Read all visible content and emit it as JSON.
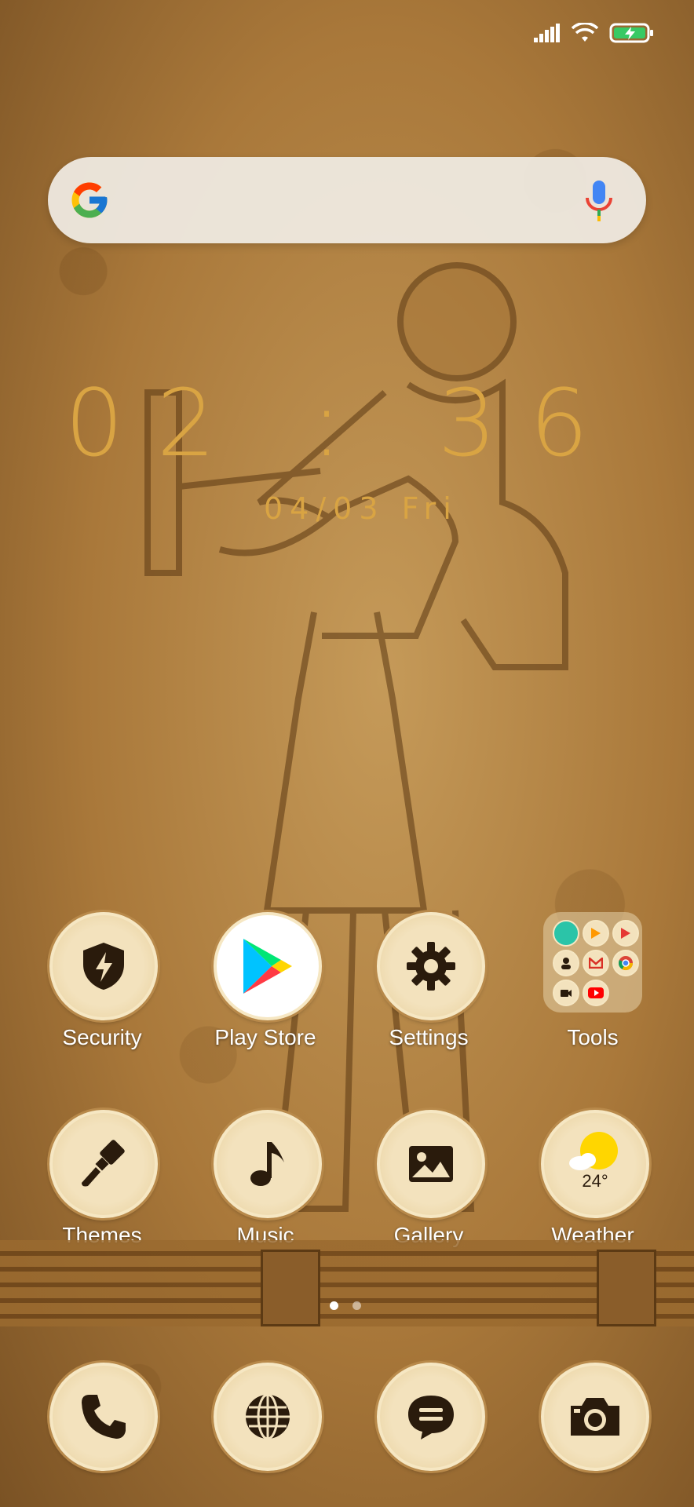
{
  "status": {
    "icons": [
      "signal-icon",
      "wifi-icon",
      "battery-charging-icon"
    ]
  },
  "search": {
    "icon_left": "google-logo-icon",
    "icon_right": "mic-icon"
  },
  "clock": {
    "time": "02 : 36",
    "date": "04/03  Fri"
  },
  "apps": [
    {
      "label": "Security",
      "icon": "shield-bolt-icon"
    },
    {
      "label": "Play Store",
      "icon": "play-store-icon"
    },
    {
      "label": "Settings",
      "icon": "gear-icon"
    },
    {
      "label": "Tools",
      "icon": "folder-icon"
    },
    {
      "label": "Themes",
      "icon": "paintbrush-icon"
    },
    {
      "label": "Music",
      "icon": "music-note-icon"
    },
    {
      "label": "Gallery",
      "icon": "image-icon"
    },
    {
      "label": "Weather",
      "icon": "weather-sun-icon",
      "temp": "24°"
    }
  ],
  "dock": [
    "phone-icon",
    "globe-icon",
    "messages-icon",
    "camera-icon"
  ],
  "pages": {
    "count": 2,
    "current": 1
  },
  "colors": {
    "accent": "#d9a443",
    "icon_bg": "#f3e2bd",
    "icon_fg": "#2a1b0c"
  }
}
